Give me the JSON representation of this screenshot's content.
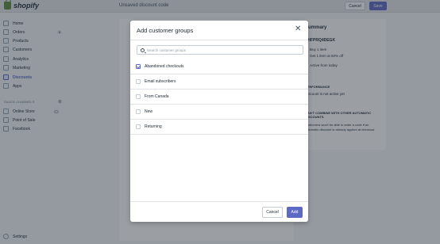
{
  "topbar": {
    "logo": "shopify",
    "title": "Unsaved discount code",
    "cancel": "Cancel",
    "save": "Save"
  },
  "sidebar": {
    "items": [
      {
        "label": "Home",
        "icon": "home-icon"
      },
      {
        "label": "Orders",
        "icon": "orders-icon",
        "badge": "8"
      },
      {
        "label": "Products",
        "icon": "tag-icon"
      },
      {
        "label": "Customers",
        "icon": "person-icon"
      },
      {
        "label": "Analytics",
        "icon": "chart-icon"
      },
      {
        "label": "Marketing",
        "icon": "megaphone-icon"
      },
      {
        "label": "Discounts",
        "icon": "discount-icon",
        "active": true
      },
      {
        "label": "Apps",
        "icon": "apps-icon"
      }
    ],
    "channels_title": "SALES CHANNELS",
    "channels": [
      {
        "label": "Online Store",
        "icon": "store-icon"
      },
      {
        "label": "Point of Sale",
        "icon": "pos-icon"
      },
      {
        "label": "Facebook",
        "icon": "facebook-icon"
      }
    ],
    "settings": "Settings"
  },
  "background": {
    "summary_title": "Summary",
    "code": "SHFPRQ4DEGK",
    "line1": "Buy 1 item",
    "line2": "Get 1 item at 50% off",
    "line3": "Active from today",
    "performance": "PERFORMANCE",
    "performance_text": "Discount is not active yet",
    "combine_title": "CAN'T COMBINE WITH OTHER AUTOMATIC DISCOUNTS",
    "combine_text": "Customers won't be able to enter a code if an automatic discount is already applied at checkout."
  },
  "modal": {
    "title": "Add customer groups",
    "search_placeholder": "Search customer groups",
    "options": [
      {
        "label": "Abandoned checkouts",
        "checked": true
      },
      {
        "label": "Email subscribers",
        "checked": false
      },
      {
        "label": "From Canada",
        "checked": false
      },
      {
        "label": "New",
        "checked": false
      },
      {
        "label": "Returning",
        "checked": false
      }
    ],
    "cancel": "Cancel",
    "add": "Add"
  },
  "colors": {
    "accent": "#5c6ac4",
    "brand_green": "#5e8e3e"
  }
}
